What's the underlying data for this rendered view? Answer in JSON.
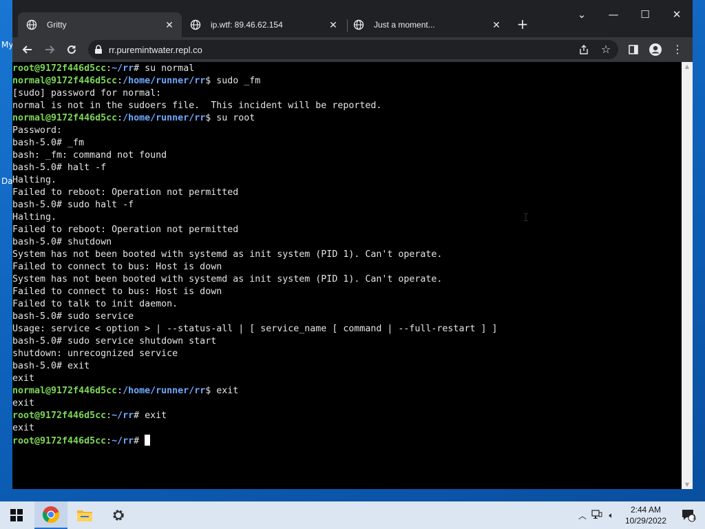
{
  "desktop": {
    "icon_labels": [
      "My",
      "Da"
    ]
  },
  "browser": {
    "tabs": [
      {
        "title": "Gritty",
        "close": "✕"
      },
      {
        "title": "ip.wtf: 89.46.62.154",
        "close": "✕"
      },
      {
        "title": "Just a moment...",
        "close": "✕"
      }
    ],
    "new_tab": "+",
    "url": "rr.puremintwater.repl.co"
  },
  "terminal": {
    "lines": [
      [
        [
          "g",
          "root@9172f446d5cc"
        ],
        [
          "w",
          ":"
        ],
        [
          "b",
          "~/rr"
        ],
        [
          "w",
          "# su normal"
        ]
      ],
      [
        [
          "g",
          "normal@9172f446d5cc"
        ],
        [
          "w",
          ":"
        ],
        [
          "b",
          "/home/runner/rr"
        ],
        [
          "w",
          "$ sudo _fm"
        ]
      ],
      [
        [
          "w",
          "[sudo] password for normal:"
        ]
      ],
      [
        [
          "w",
          "normal is not in the sudoers file.  This incident will be reported."
        ]
      ],
      [
        [
          "g",
          "normal@9172f446d5cc"
        ],
        [
          "w",
          ":"
        ],
        [
          "b",
          "/home/runner/rr"
        ],
        [
          "w",
          "$ su root"
        ]
      ],
      [
        [
          "w",
          "Password:"
        ]
      ],
      [
        [
          "w",
          "bash-5.0# _fm"
        ]
      ],
      [
        [
          "w",
          "bash: _fm: command not found"
        ]
      ],
      [
        [
          "w",
          "bash-5.0# halt -f"
        ]
      ],
      [
        [
          "w",
          "Halting."
        ]
      ],
      [
        [
          "w",
          "Failed to reboot: Operation not permitted"
        ]
      ],
      [
        [
          "w",
          "bash-5.0# sudo halt -f"
        ]
      ],
      [
        [
          "w",
          "Halting."
        ]
      ],
      [
        [
          "w",
          "Failed to reboot: Operation not permitted"
        ]
      ],
      [
        [
          "w",
          "bash-5.0# shutdown"
        ]
      ],
      [
        [
          "w",
          "System has not been booted with systemd as init system (PID 1). Can't operate."
        ]
      ],
      [
        [
          "w",
          "Failed to connect to bus: Host is down"
        ]
      ],
      [
        [
          "w",
          "System has not been booted with systemd as init system (PID 1). Can't operate."
        ]
      ],
      [
        [
          "w",
          "Failed to connect to bus: Host is down"
        ]
      ],
      [
        [
          "w",
          "Failed to talk to init daemon."
        ]
      ],
      [
        [
          "w",
          "bash-5.0# sudo service"
        ]
      ],
      [
        [
          "w",
          "Usage: service < option > | --status-all | [ service_name [ command | --full-restart ] ]"
        ]
      ],
      [
        [
          "w",
          "bash-5.0# sudo service shutdown start"
        ]
      ],
      [
        [
          "w",
          "shutdown: unrecognized service"
        ]
      ],
      [
        [
          "w",
          "bash-5.0# exit"
        ]
      ],
      [
        [
          "w",
          "exit"
        ]
      ],
      [
        [
          "g",
          "normal@9172f446d5cc"
        ],
        [
          "w",
          ":"
        ],
        [
          "b",
          "/home/runner/rr"
        ],
        [
          "w",
          "$ exit"
        ]
      ],
      [
        [
          "w",
          "exit"
        ]
      ],
      [
        [
          "g",
          "root@9172f446d5cc"
        ],
        [
          "w",
          ":"
        ],
        [
          "b",
          "~/rr"
        ],
        [
          "w",
          "# exit"
        ]
      ],
      [
        [
          "w",
          "exit"
        ]
      ],
      [
        [
          "g",
          "root@9172f446d5cc"
        ],
        [
          "w",
          ":"
        ],
        [
          "b",
          "~/rr"
        ],
        [
          "w",
          "# "
        ],
        [
          "cursor",
          ""
        ]
      ]
    ]
  },
  "taskbar": {
    "time": "2:44 AM",
    "date": "10/29/2022",
    "notification_count": "1"
  }
}
